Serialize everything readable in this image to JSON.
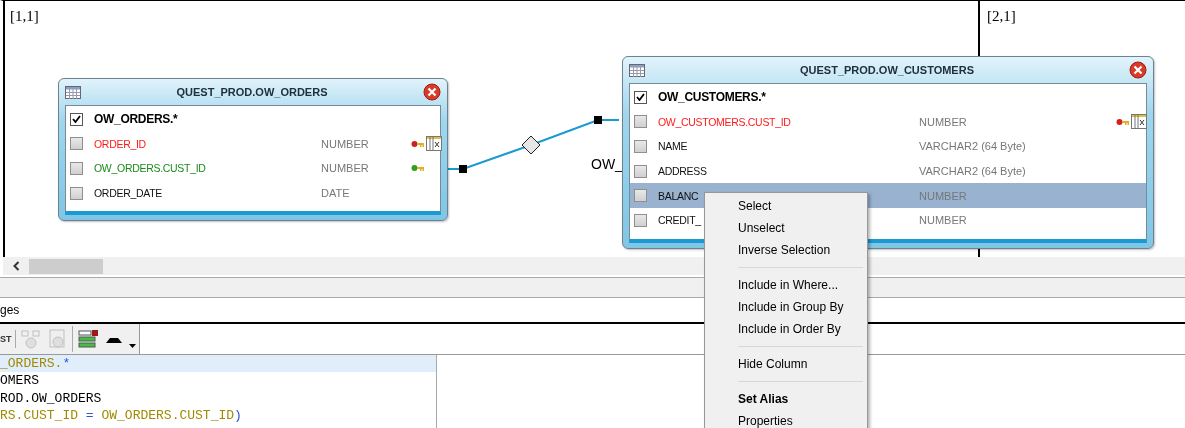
{
  "canvas": {
    "regions": [
      {
        "label": "[1,1]"
      },
      {
        "label": "[2,1]"
      }
    ],
    "join_label": "OW_"
  },
  "tables": [
    {
      "title": "QUEST_PROD.OW_ORDERS",
      "columns": [
        {
          "name": "OW_ORDERS.*",
          "kind": "all",
          "checked": true,
          "selected": false
        },
        {
          "name": "ORDER_ID",
          "type": "NUMBER",
          "kind": "primary_key",
          "checked": false,
          "selected": false
        },
        {
          "name": "OW_ORDERS.CUST_ID",
          "type": "NUMBER",
          "kind": "foreign_key",
          "checked": false,
          "selected": false
        },
        {
          "name": "ORDER_DATE",
          "type": "DATE",
          "kind": "column",
          "checked": false,
          "selected": false
        }
      ]
    },
    {
      "title": "QUEST_PROD.OW_CUSTOMERS",
      "columns": [
        {
          "name": "OW_CUSTOMERS.*",
          "kind": "all",
          "checked": true,
          "selected": false
        },
        {
          "name": "OW_CUSTOMERS.CUST_ID",
          "type": "NUMBER",
          "kind": "primary_key",
          "checked": false,
          "selected": false
        },
        {
          "name": "NAME",
          "type": "VARCHAR2 (64 Byte)",
          "kind": "column",
          "checked": false,
          "selected": false
        },
        {
          "name": "ADDRESS",
          "type": "VARCHAR2 (64 Byte)",
          "kind": "column",
          "checked": false,
          "selected": false
        },
        {
          "name": "BALANC",
          "type": "NUMBER",
          "kind": "column",
          "checked": false,
          "selected": true
        },
        {
          "name": "CREDIT_",
          "type": "NUMBER",
          "kind": "column",
          "checked": false,
          "selected": false
        }
      ]
    }
  ],
  "context_menu": [
    {
      "kind": "item",
      "label": "Select",
      "default": false
    },
    {
      "kind": "item",
      "label": "Unselect",
      "default": false
    },
    {
      "kind": "item",
      "label": "Inverse Selection",
      "default": false
    },
    {
      "kind": "separator"
    },
    {
      "kind": "item",
      "label": "Include in Where...",
      "default": false
    },
    {
      "kind": "item",
      "label": "Include in Group By",
      "default": false
    },
    {
      "kind": "item",
      "label": "Include in Order By",
      "default": false
    },
    {
      "kind": "separator"
    },
    {
      "kind": "item",
      "label": "Hide Column",
      "default": false
    },
    {
      "kind": "separator"
    },
    {
      "kind": "item",
      "label": "Set Alias",
      "default": true
    },
    {
      "kind": "item",
      "label": "Properties",
      "default": false
    }
  ],
  "messages_tab": {
    "label": "ges"
  },
  "toolbar": {
    "button_label": "ST"
  },
  "sql_lines": [
    {
      "highlighted": true,
      "tokens": [
        {
          "text": "_ORDERS.",
          "kind": "ident"
        },
        {
          "text": "*",
          "kind": "op"
        }
      ]
    },
    {
      "highlighted": false,
      "tokens": [
        {
          "text": "OMERS",
          "kind": "plain"
        }
      ]
    },
    {
      "highlighted": false,
      "tokens": [
        {
          "text": "ROD.OW_ORDERS",
          "kind": "plain"
        }
      ]
    },
    {
      "highlighted": false,
      "tokens": [
        {
          "text": "RS.CUST_ID ",
          "kind": "ident"
        },
        {
          "text": "=",
          "kind": "op"
        },
        {
          "text": " OW_ORDERS.CUST_ID",
          "kind": "ident"
        },
        {
          "text": ")",
          "kind": "op"
        }
      ]
    }
  ]
}
